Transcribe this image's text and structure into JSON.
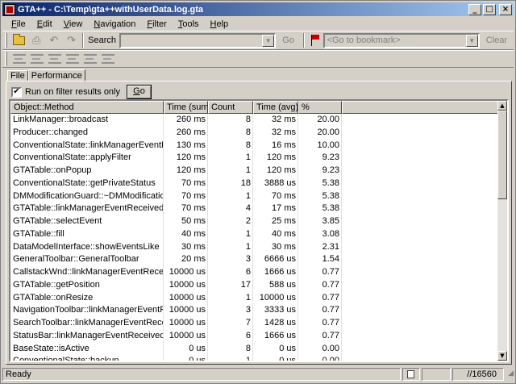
{
  "window": {
    "title": "GTA++  -  C:\\Temp\\gta++withUserData.log.gta",
    "controls": {
      "minimize": "_",
      "maximize": "□",
      "close": "×"
    }
  },
  "menu": [
    {
      "u": "F",
      "rest": "ile"
    },
    {
      "u": "E",
      "rest": "dit"
    },
    {
      "u": "V",
      "rest": "iew"
    },
    {
      "u": "N",
      "rest": "avigation"
    },
    {
      "u": "F",
      "rest": "ilter"
    },
    {
      "u": "T",
      "rest": "ools"
    },
    {
      "u": "H",
      "rest": "elp"
    }
  ],
  "toolbar": {
    "search_label": "Search",
    "search_value": "",
    "go_label": "Go",
    "bookmarks_placeholder": "<Go to bookmark>",
    "clear_label": "Clear"
  },
  "tabs": [
    "File",
    "Performance"
  ],
  "filter": {
    "checkbox_checked": true,
    "checkbox_mark": "✔",
    "label": "Run on filter results only",
    "go_u": "G",
    "go_rest": "o"
  },
  "table": {
    "columns": [
      "Object::Method",
      "Time (sum)",
      "Count",
      "Time (avg)",
      "%"
    ],
    "rows": [
      [
        "LinkManager::broadcast",
        "260 ms",
        "8",
        "32 ms",
        "20.00"
      ],
      [
        "Producer::changed",
        "260 ms",
        "8",
        "32 ms",
        "20.00"
      ],
      [
        "ConventionalState::linkManagerEventReceived",
        "130 ms",
        "8",
        "16 ms",
        "10.00"
      ],
      [
        "ConventionalState::applyFilter",
        "120 ms",
        "1",
        "120 ms",
        "9.23"
      ],
      [
        "GTATable::onPopup",
        "120 ms",
        "1",
        "120 ms",
        "9.23"
      ],
      [
        "ConventionalState::getPrivateStatus",
        "70 ms",
        "18",
        "3888 us",
        "5.38"
      ],
      [
        "DMModificationGuard::~DMModificationGuard",
        "70 ms",
        "1",
        "70 ms",
        "5.38"
      ],
      [
        "GTATable::linkManagerEventReceived",
        "70 ms",
        "4",
        "17 ms",
        "5.38"
      ],
      [
        "GTATable::selectEvent",
        "50 ms",
        "2",
        "25 ms",
        "3.85"
      ],
      [
        "GTATable::fill",
        "40 ms",
        "1",
        "40 ms",
        "3.08"
      ],
      [
        "DataModelInterface::showEventsLike",
        "30 ms",
        "1",
        "30 ms",
        "2.31"
      ],
      [
        "GeneralToolbar::GeneralToolbar",
        "20 ms",
        "3",
        "6666 us",
        "1.54"
      ],
      [
        "CallstackWnd::linkManagerEventReceived",
        "10000 us",
        "6",
        "1666 us",
        "0.77"
      ],
      [
        "GTATable::getPosition",
        "10000 us",
        "17",
        "588 us",
        "0.77"
      ],
      [
        "GTATable::onResize",
        "10000 us",
        "1",
        "10000 us",
        "0.77"
      ],
      [
        "NavigationToolbar::linkManagerEventReceived",
        "10000 us",
        "3",
        "3333 us",
        "0.77"
      ],
      [
        "SearchToolbar::linkManagerEventReceived",
        "10000 us",
        "7",
        "1428 us",
        "0.77"
      ],
      [
        "StatusBar::linkManagerEventReceived",
        "10000 us",
        "6",
        "1666 us",
        "0.77"
      ],
      [
        "BaseState::isActive",
        "0 us",
        "8",
        "0 us",
        "0.00"
      ],
      [
        "ConventionalState::backup",
        "0 us",
        "1",
        "0 us",
        "0.00"
      ]
    ]
  },
  "status": {
    "text": "Ready",
    "count": "//16560"
  }
}
